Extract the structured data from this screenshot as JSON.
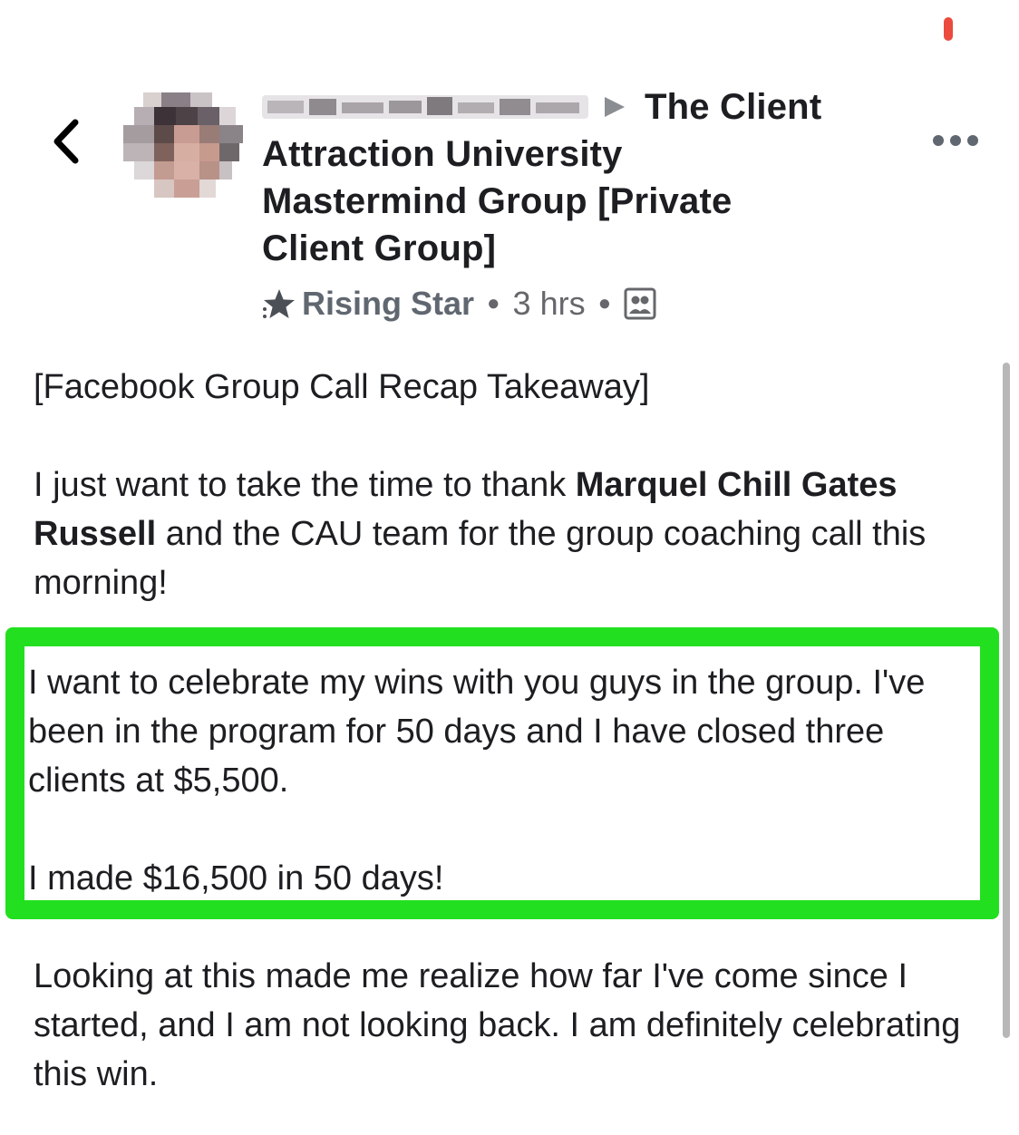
{
  "status": {
    "recording_dot_color": "#eb4a3d"
  },
  "header": {
    "back_icon": "chevron-left-icon",
    "author_name": "",
    "arrow_icon": "triangle-right-icon",
    "group_line1": "The Client",
    "group_line2": "Attraction University",
    "group_line3": "Mastermind Group [Private",
    "group_line4": "Client Group]",
    "badge_icon": "star-icon",
    "rank_label": "Rising Star",
    "time_label": "3 hrs",
    "audience_icon": "group-members-icon",
    "more_icon": "more-horizontal-icon"
  },
  "post": {
    "heading": "[Facebook Group Call Recap Takeaway]",
    "thanks_pre": "I just want to take the time to thank ",
    "thanks_name": "Marquel Chill Gates Russell",
    "thanks_post": " and the CAU team for the group coaching call this morning!",
    "highlight_p1": "I want to celebrate my wins with you guys in the group. I've been in the program for 50 days and I have closed three clients at $5,500.",
    "highlight_p2": "I made $16,500 in 50 days!",
    "closing": "Looking at this made me realize how far I've come since I started, and I am not looking back. I am definitely celebrating this win."
  },
  "colors": {
    "highlight_border": "#22e01f",
    "text": "#1c1e21",
    "meta_text": "#65676b"
  }
}
